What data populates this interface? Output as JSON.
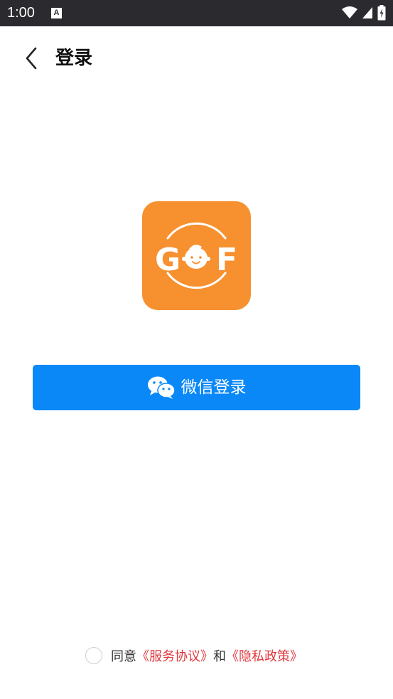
{
  "status_bar": {
    "time": "1:00",
    "notification_letter": "A"
  },
  "nav": {
    "title": "登录"
  },
  "logo": {
    "letter_left": "G",
    "letter_right": "F"
  },
  "wechat_login": {
    "label": "微信登录"
  },
  "agreement": {
    "prefix": "同意",
    "service_link": "《服务协议》",
    "conjunction": "和",
    "privacy_link": "《隐私政策》"
  },
  "colors": {
    "status_bar_bg": "#2b2b2f",
    "primary_blue": "#0a88f8",
    "logo_orange": "#f7902f",
    "link_red": "#e0383e"
  }
}
